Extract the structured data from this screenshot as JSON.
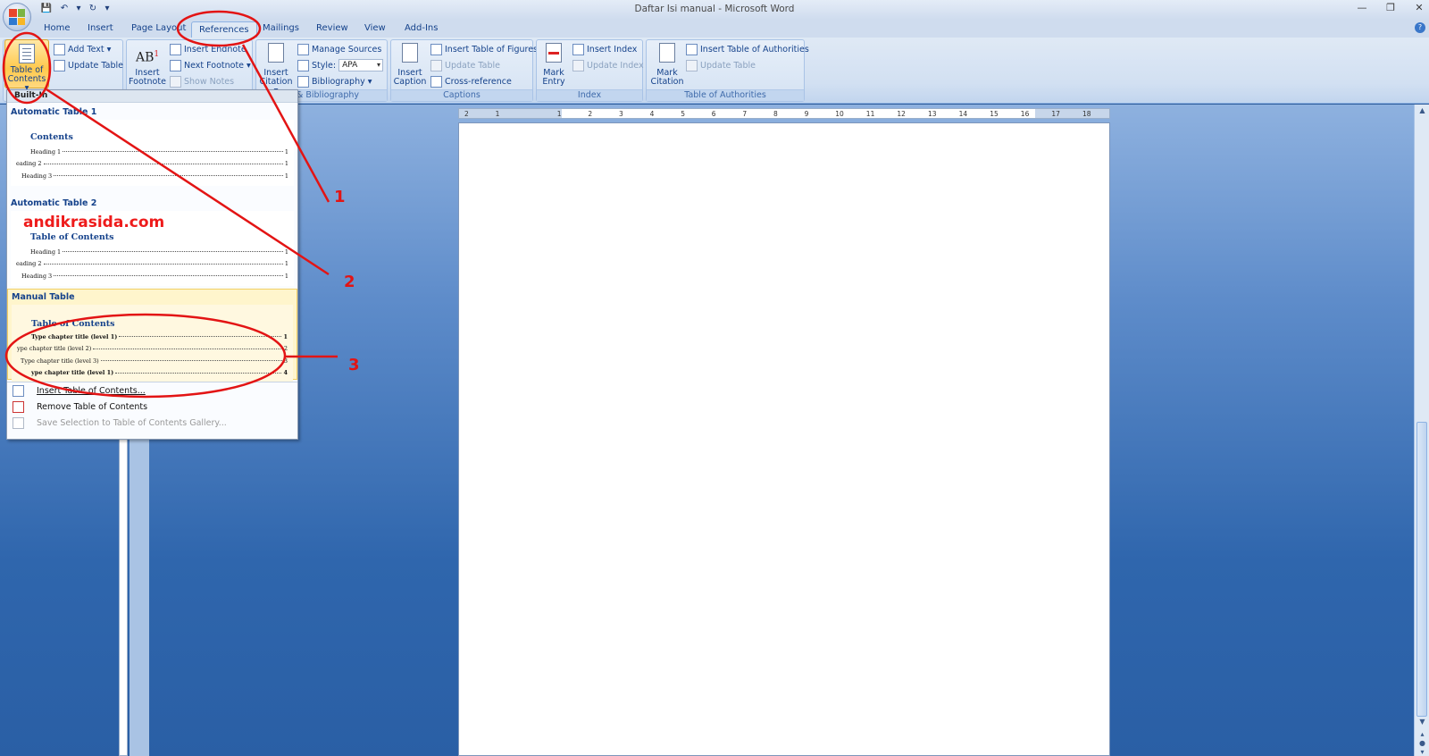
{
  "window": {
    "title": "Daftar Isi manual - Microsoft Word",
    "controls": [
      "—",
      "❐",
      "✕"
    ]
  },
  "qat": [
    "💾",
    "↶",
    "▾",
    "↻",
    "▾"
  ],
  "tabs": [
    "Home",
    "Insert",
    "Page Layout",
    "References",
    "Mailings",
    "Review",
    "View",
    "Add-Ins"
  ],
  "active_tab": "References",
  "ribbon": {
    "toc_group": {
      "toc_button": "Table of Contents ▾",
      "toc_line1": "Table of",
      "toc_line2": "Contents ▾",
      "add_text": "Add Text ▾",
      "update_table": "Update Table"
    },
    "footnotes_group": {
      "insert_footnote_line1": "Insert",
      "insert_footnote_line2": "Footnote",
      "insert_endnote": "Insert Endnote",
      "next_footnote": "Next Footnote ▾",
      "show_notes": "Show Notes"
    },
    "citations_group": {
      "insert_citation_line1": "Insert",
      "insert_citation_line2": "Citation ▾",
      "manage_sources": "Manage Sources",
      "style_label": "Style:",
      "style_value": "APA",
      "bibliography": "Bibliography ▾",
      "label": "ns & Bibliography"
    },
    "captions_group": {
      "insert_caption_line1": "Insert",
      "insert_caption_line2": "Caption",
      "insert_table_of_figures": "Insert Table of Figures",
      "update_table": "Update Table",
      "cross_reference": "Cross-reference",
      "label": "Captions"
    },
    "index_group": {
      "mark_entry_line1": "Mark",
      "mark_entry_line2": "Entry",
      "insert_index": "Insert Index",
      "update_index": "Update Index",
      "label": "Index"
    },
    "authorities_group": {
      "mark_citation_line1": "Mark",
      "mark_citation_line2": "Citation",
      "insert_table_of_authorities": "Insert Table of Authorities",
      "update_table": "Update Table",
      "label": "Table of Authorities"
    }
  },
  "gallery": {
    "header": "Built-In",
    "auto1": {
      "title": "Automatic Table 1",
      "heading": "Contents",
      "lines": [
        {
          "text": "Heading 1",
          "num": "1"
        },
        {
          "text": "eading 2",
          "num": "1"
        },
        {
          "text": "Heading 3",
          "num": "1"
        }
      ]
    },
    "auto2": {
      "title": "Automatic Table 2",
      "heading": "Table of Contents",
      "lines": [
        {
          "text": "Heading 1",
          "num": "1"
        },
        {
          "text": "eading 2",
          "num": "1"
        },
        {
          "text": "Heading 3",
          "num": "1"
        }
      ]
    },
    "manual": {
      "title": "Manual Table",
      "heading": "Table of Contents",
      "lines": [
        {
          "text": "Type chapter title (level 1)",
          "num": "1"
        },
        {
          "text": "ype chapter title (level 2)",
          "num": "2"
        },
        {
          "text": "Type chapter title (level 3)",
          "num": "3"
        },
        {
          "text": "ype chapter title (level 1)",
          "num": "4"
        }
      ]
    },
    "menu": {
      "insert": "Insert Table of Contents...",
      "remove": "Remove Table of Contents",
      "save": "Save Selection to Table of Contents Gallery..."
    }
  },
  "ruler": [
    "2",
    "1",
    "1",
    "2",
    "3",
    "4",
    "5",
    "6",
    "7",
    "8",
    "9",
    "10",
    "11",
    "12",
    "13",
    "14",
    "15",
    "16",
    "17",
    "18"
  ],
  "watermark": "andikrasida.com",
  "annotations": [
    "1",
    "2",
    "3"
  ],
  "colors": {
    "annotation_red": "#e31414",
    "ribbon_text": "#15428b",
    "toc_highlight": "#ffc94d"
  }
}
